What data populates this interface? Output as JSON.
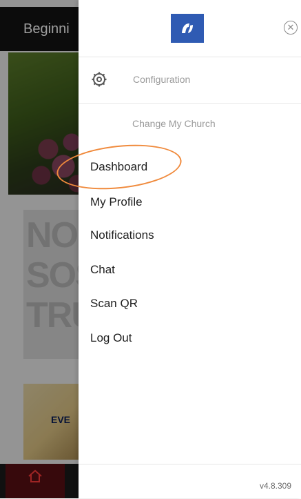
{
  "background": {
    "header_title": "Beginni",
    "card1_text": "NO SOS TRU",
    "card2_text": "EVE"
  },
  "drawer": {
    "configuration_label": "Configuration",
    "change_church_label": "Change My Church",
    "menu_items": [
      {
        "label": "Dashboard",
        "highlighted": true
      },
      {
        "label": "My Profile"
      },
      {
        "label": "Notifications"
      },
      {
        "label": "Chat"
      },
      {
        "label": "Scan QR"
      },
      {
        "label": "Log Out"
      }
    ],
    "version": "v4.8.309"
  },
  "colors": {
    "logo_blue": "#2f5bb3",
    "highlight_orange": "#f08a3c",
    "menu_text": "#1e1e1e",
    "muted_text": "#9a9a9a"
  },
  "icons": {
    "close": "close-circle-icon",
    "configuration": "gear-icon",
    "logo": "app-logo-icon",
    "home": "home-icon"
  }
}
